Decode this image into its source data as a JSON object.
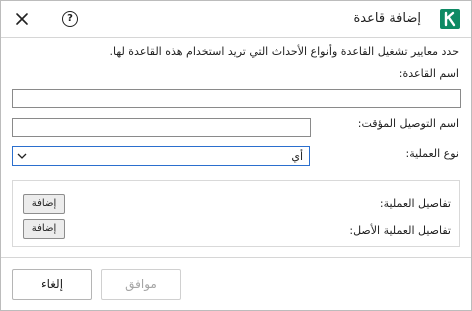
{
  "dialog": {
    "title": "إضافة قاعدة",
    "brand_letter": "k",
    "help_glyph": "?",
    "accent_color": "#0e8a64"
  },
  "form": {
    "description": "حدد معايير تشغيل القاعدة وأنواع الأحداث التي تريد استخدام هذه القاعدة لها.",
    "rule_name_label": "اسم القاعدة:",
    "rule_name_value": "",
    "alias_label": "اسم التوصيل المؤقت:",
    "alias_value": "",
    "operation_type_label": "نوع العملية:",
    "operation_type_value": "أي"
  },
  "details": {
    "operation_details_label": "تفاصيل العملية:",
    "operation_details_add": "إضافة",
    "parent_details_label": "تفاصيل العملية الأصل:",
    "parent_details_add": "إضافة"
  },
  "footer": {
    "ok_label": "موافق",
    "ok_disabled": true,
    "cancel_label": "إلغاء"
  }
}
